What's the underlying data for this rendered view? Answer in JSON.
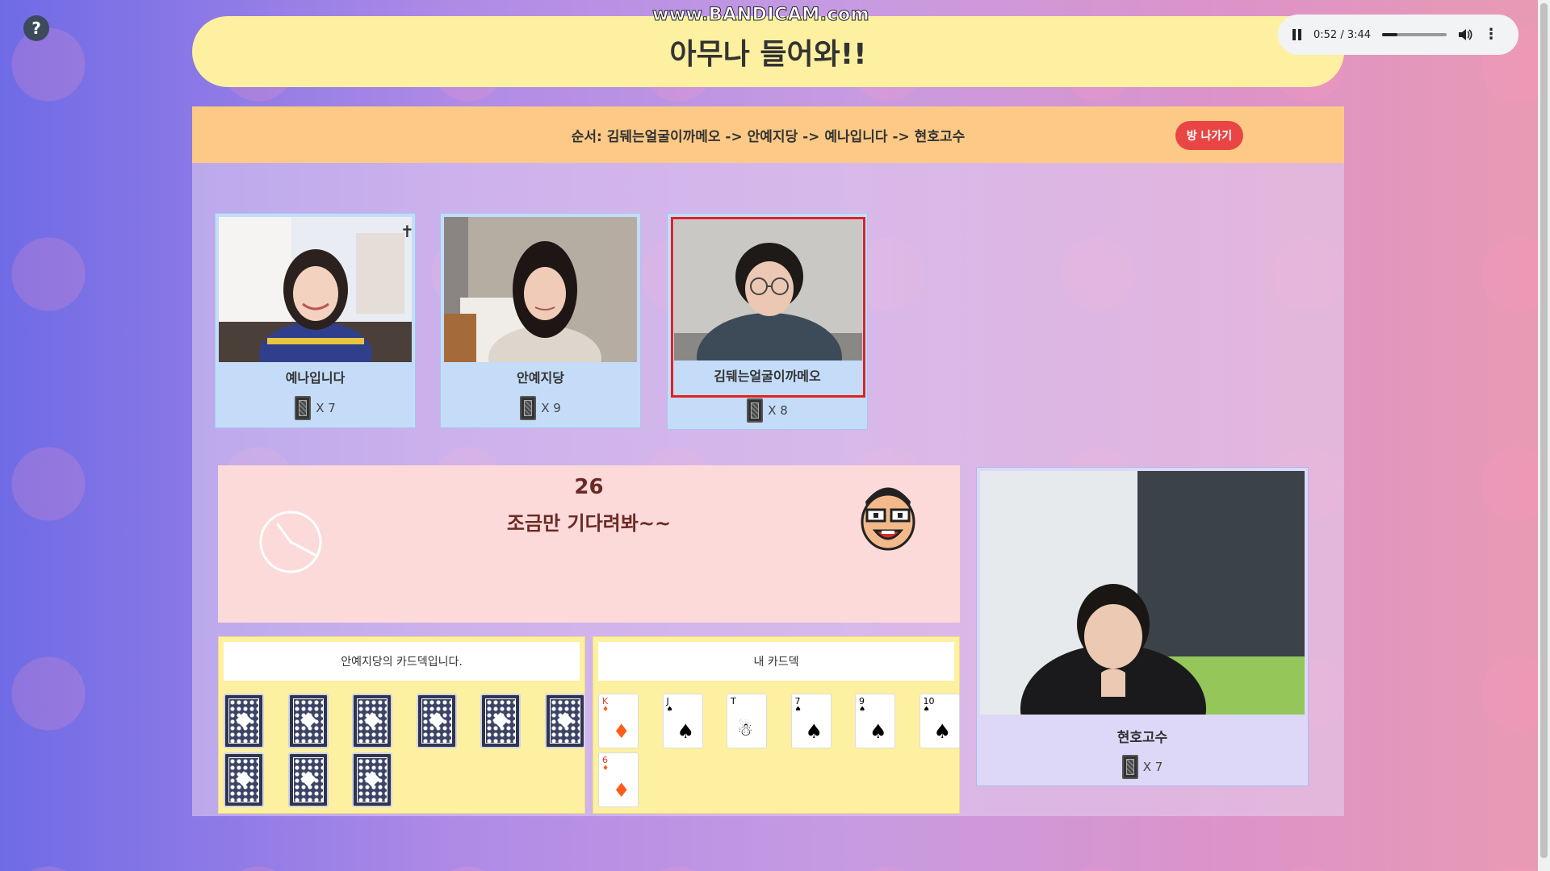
{
  "watermark": "www.BANDICAM.com",
  "help": "?",
  "room_title": "아무나 들어와!!",
  "media_player": {
    "time": "0:52 / 3:44",
    "progress": 0.235,
    "volume": 1.0
  },
  "order": {
    "text": "순서: 김뒈는얼굴이까메오 -> 안예지당 -> 예나입니다 -> 현호고수"
  },
  "leave_button": "방 나가기",
  "players": [
    {
      "name": "예나입니다",
      "count": "X 7"
    },
    {
      "name": "안예지당",
      "count": "X 9"
    },
    {
      "name": "김뒈는얼굴이까메오",
      "count": "X 8"
    }
  ],
  "timer": {
    "count": "26",
    "message": "조금만 기다려봐~~"
  },
  "opponent_deck": {
    "title": "안예지당의 카드덱입니다.",
    "card_count": 9
  },
  "my_deck": {
    "title": "내 카드덱",
    "cards": [
      {
        "rank": "K",
        "suit": "♦",
        "color": "red"
      },
      {
        "rank": "J",
        "suit": "♠",
        "color": "black"
      },
      {
        "rank": "T",
        "suit": "joker",
        "color": "black"
      },
      {
        "rank": "7",
        "suit": "♠",
        "color": "black"
      },
      {
        "rank": "9",
        "suit": "♠",
        "color": "black"
      },
      {
        "rank": "10",
        "suit": "♠",
        "color": "black"
      },
      {
        "rank": "6",
        "suit": "♦",
        "color": "red"
      }
    ]
  },
  "self_player": {
    "name": "현호고수",
    "count": "X 7"
  },
  "colors": {
    "title_bg": "#fdf0a0",
    "order_bg": "#fcca86",
    "leave_btn": "#e94545",
    "active_border": "#e52020"
  }
}
